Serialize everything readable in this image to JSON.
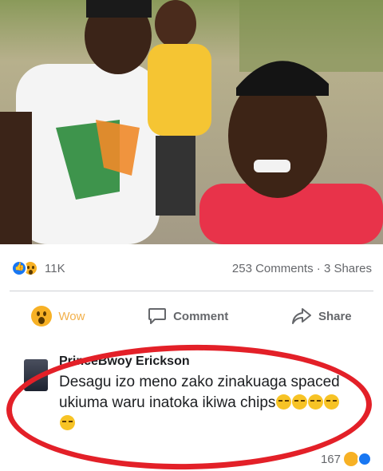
{
  "post": {
    "reaction_count": "11K",
    "comments": "253 Comments",
    "separator": "·",
    "shares": "3 Shares",
    "reactions_shown": [
      "like-icon",
      "wow-icon"
    ]
  },
  "actions": {
    "wow_label": "Wow",
    "comment_label": "Comment",
    "share_label": "Share"
  },
  "comment": {
    "author": "PrinceBwoy Erickson",
    "text": "Desagu izo meno zako zinakuaga spaced ukiuma waru inatoka ikiwa chips",
    "emoji_count": 5,
    "likes": "167"
  },
  "colors": {
    "facebook_blue": "#1877f2",
    "wow_yellow": "#f7b125",
    "highlight_red": "#e32028"
  }
}
